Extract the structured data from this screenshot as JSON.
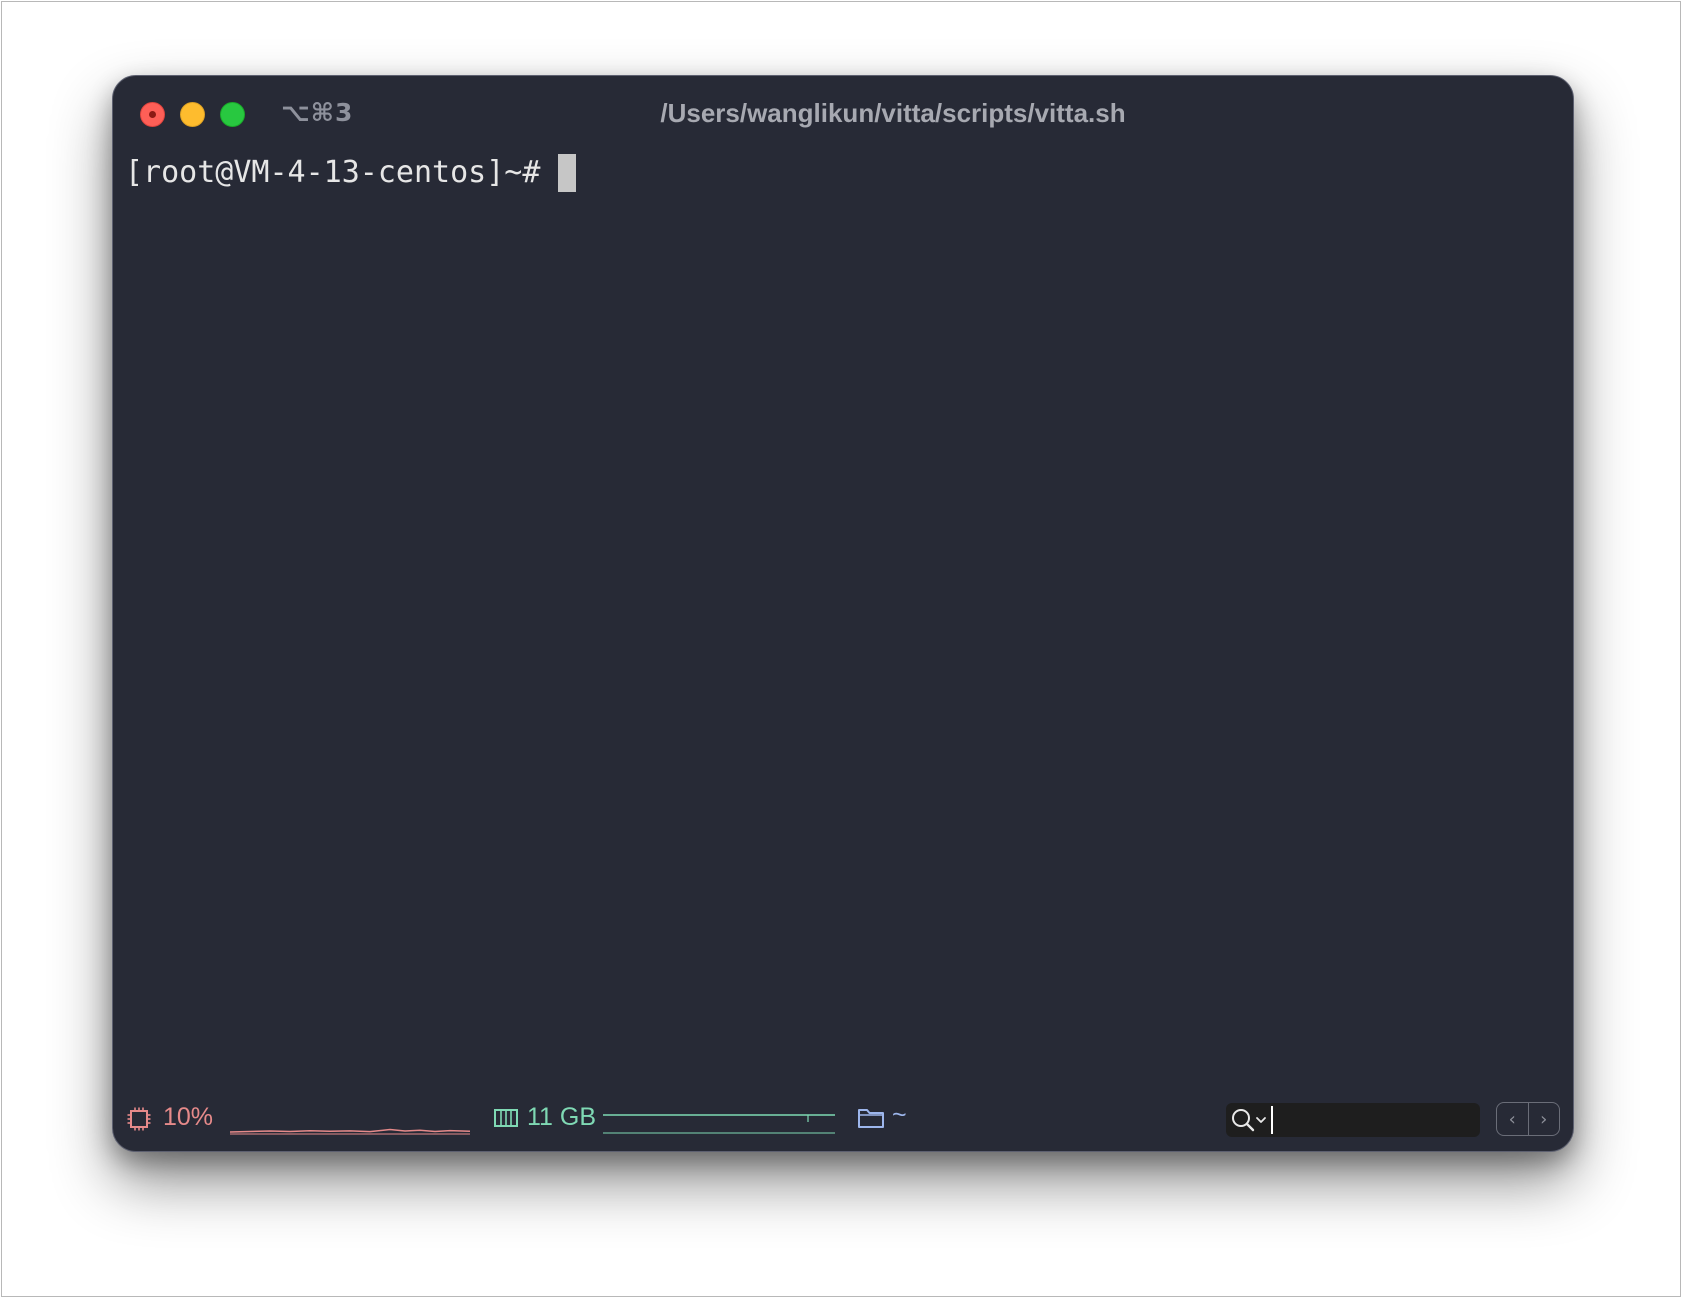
{
  "window": {
    "shortcut": "⌥⌘3",
    "title": "/Users/wanglikun/vitta/scripts/vitta.sh"
  },
  "terminal": {
    "prompt": "[root@VM-4-13-centos]~#"
  },
  "status_bar": {
    "cpu": {
      "icon": "cpu-icon",
      "value": "10%",
      "color": "#e68a8a"
    },
    "memory": {
      "icon": "memory-icon",
      "value": "11 GB",
      "color": "#7fd9b4"
    },
    "directory": {
      "icon": "folder-icon",
      "value": "~",
      "color": "#9db6ec"
    },
    "search": {
      "icon": "search-icon",
      "value": ""
    },
    "nav": {
      "prev": "‹",
      "next": "›"
    }
  },
  "colors": {
    "terminal_background": "#272a36",
    "close": "#fe5f57",
    "minimize": "#febc2e",
    "zoom": "#28c840"
  }
}
